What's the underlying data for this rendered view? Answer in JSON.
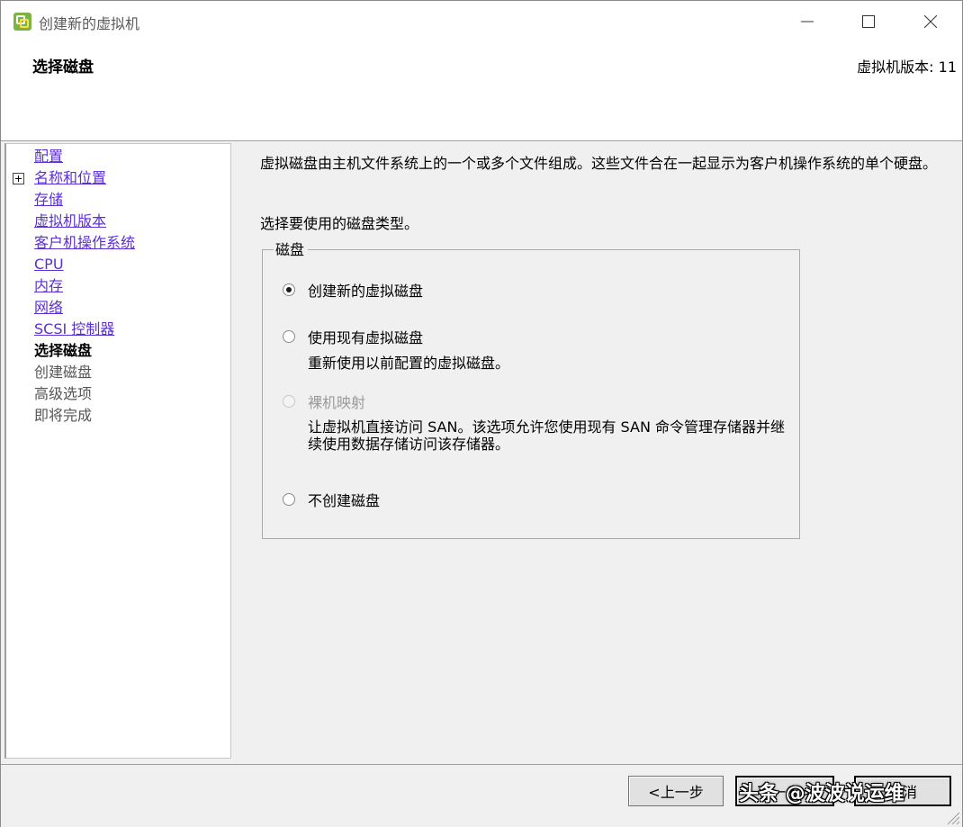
{
  "window": {
    "title": "创建新的虚拟机",
    "controls": [
      "minimize",
      "maximize",
      "close"
    ]
  },
  "header": {
    "title": "选择磁盘",
    "version": "虚拟机版本: 11"
  },
  "nav": {
    "items": [
      {
        "label": "配置",
        "state": "link"
      },
      {
        "label": "名称和位置",
        "state": "link",
        "expandable": true
      },
      {
        "label": "存储",
        "state": "link"
      },
      {
        "label": "虚拟机版本",
        "state": "link"
      },
      {
        "label": "客户机操作系统",
        "state": "link"
      },
      {
        "label": "CPU",
        "state": "link"
      },
      {
        "label": "内存",
        "state": "link"
      },
      {
        "label": "网络",
        "state": "link"
      },
      {
        "label": "SCSI 控制器",
        "state": "link"
      },
      {
        "label": "选择磁盘",
        "state": "current"
      },
      {
        "label": "创建磁盘",
        "state": "disabled"
      },
      {
        "label": "高级选项",
        "state": "disabled"
      },
      {
        "label": "即将完成",
        "state": "disabled"
      }
    ]
  },
  "main": {
    "description": "虚拟磁盘由主机文件系统上的一个或多个文件组成。这些文件合在一起显示为客户机操作系统的单个硬盘。",
    "prompt": "选择要使用的磁盘类型。",
    "group_label": "磁盘",
    "options": [
      {
        "label": "创建新的虚拟磁盘",
        "checked": true,
        "enabled": true,
        "sub": ""
      },
      {
        "label": "使用现有虚拟磁盘",
        "checked": false,
        "enabled": true,
        "sub": "重新使用以前配置的虚拟磁盘。"
      },
      {
        "label": "裸机映射",
        "checked": false,
        "enabled": false,
        "sub": "让虚拟机直接访问 SAN。该选项允许您使用现有 SAN 命令管理存储器并继续使用数据存储访问该存储器。"
      },
      {
        "label": "不创建磁盘",
        "checked": false,
        "enabled": true,
        "sub": ""
      }
    ]
  },
  "footer": {
    "back_label": "<上一步",
    "next_label": "下一步>",
    "cancel_label": "取消",
    "watermark": "头条 @波波说运维"
  },
  "colors": {
    "link": "#5b2fd6",
    "background": "#f0f0f0"
  }
}
